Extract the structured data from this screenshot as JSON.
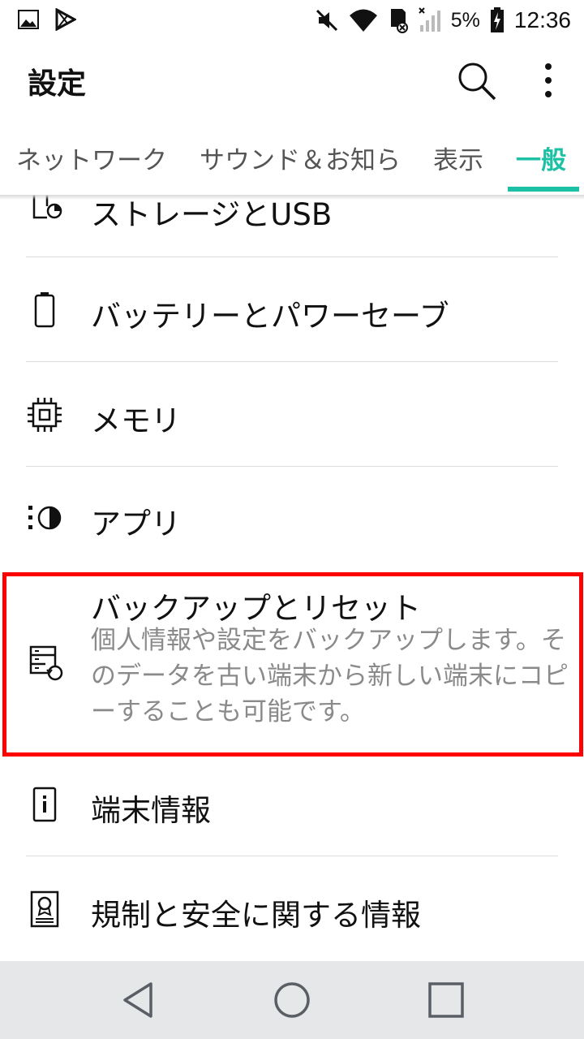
{
  "status_bar": {
    "battery_percent": "5%",
    "time": "12:36"
  },
  "app_bar": {
    "title": "設定"
  },
  "tabs": [
    {
      "label": "ネットワーク",
      "selected": false
    },
    {
      "label": "サウンド＆お知ら",
      "selected": false
    },
    {
      "label": "表示",
      "selected": false
    },
    {
      "label": "一般",
      "selected": true
    }
  ],
  "accent_color": "#1cc0a5",
  "highlight_color": "#ff0000",
  "settings_items": [
    {
      "label": "ストレージとUSB",
      "icon": "storage-icon"
    },
    {
      "label": "バッテリーとパワーセーブ",
      "icon": "battery-icon"
    },
    {
      "label": "メモリ",
      "icon": "memory-chip-icon"
    },
    {
      "label": "アプリ",
      "icon": "apps-icon"
    },
    {
      "label": "バックアップとリセット",
      "icon": "backup-reset-icon",
      "description": "個人情報や設定をバックアップします。そのデータを古い端末から新しい端末にコピーすることも可能です。"
    },
    {
      "label": "端末情報",
      "icon": "info-icon"
    },
    {
      "label": "規制と安全に関する情報",
      "icon": "certificate-icon"
    }
  ]
}
